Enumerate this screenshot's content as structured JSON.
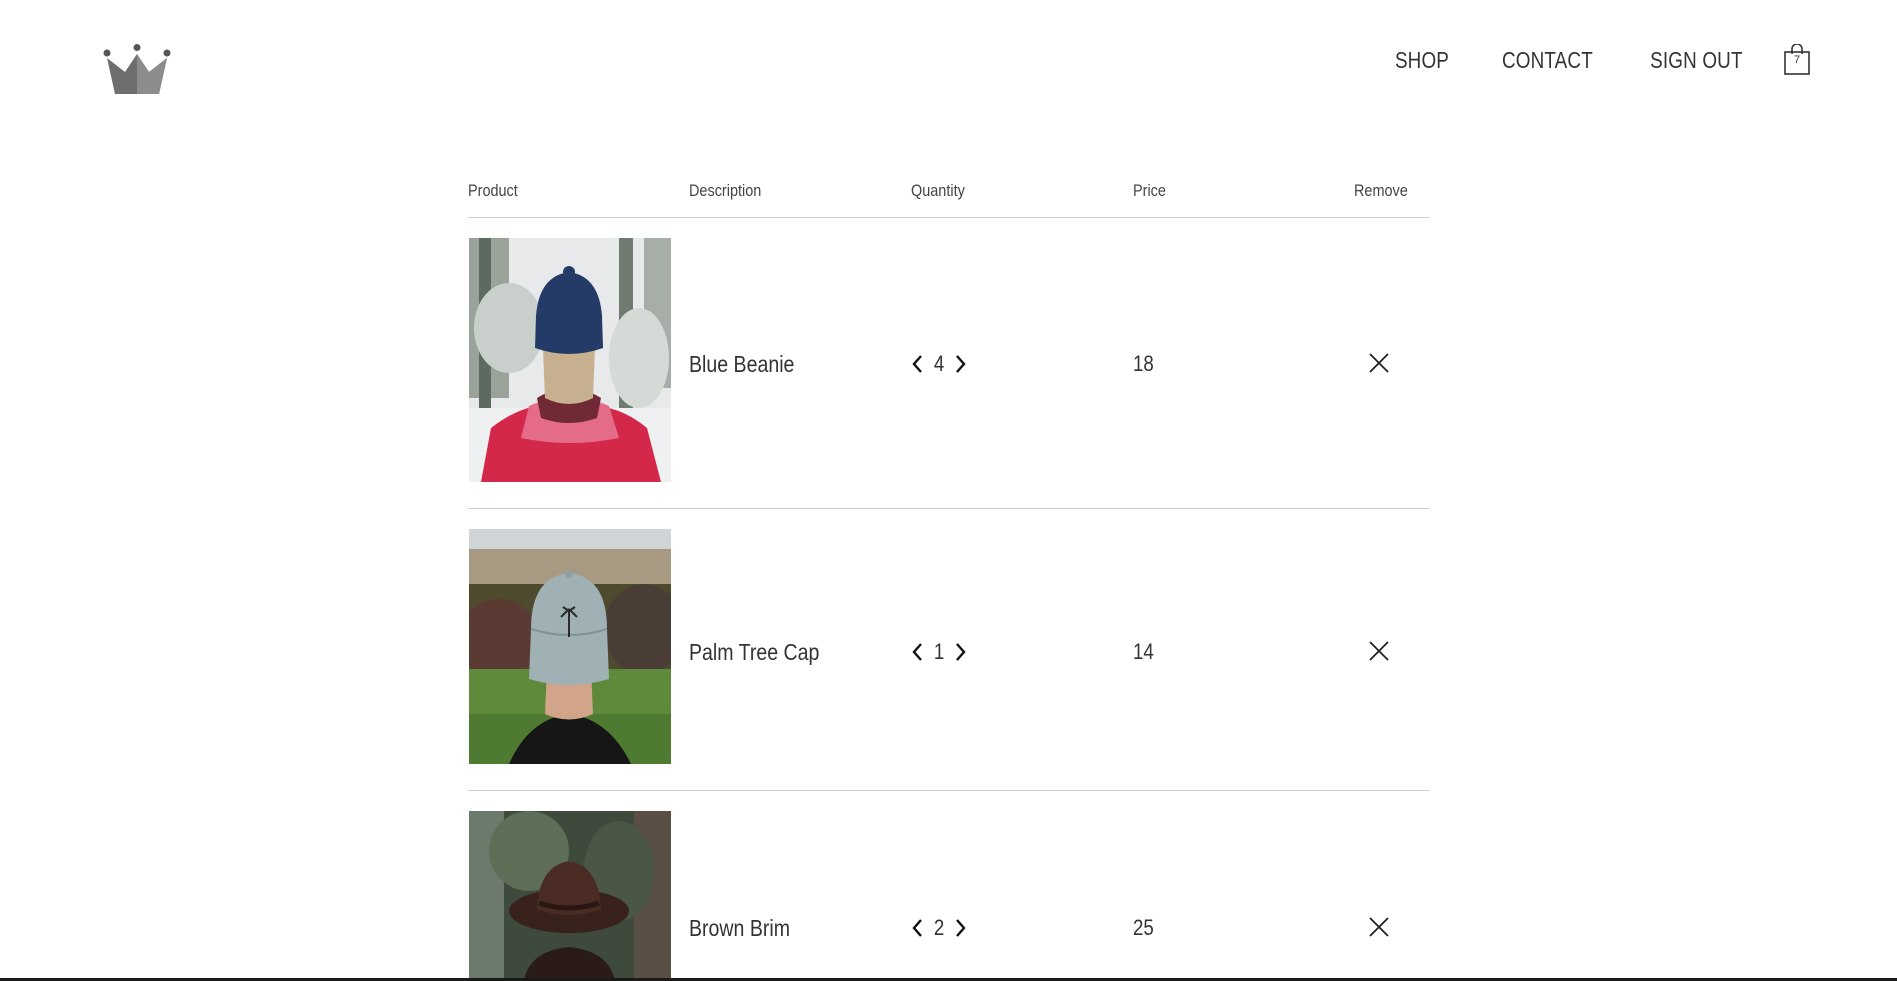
{
  "header": {
    "logo_icon": "crown-icon",
    "nav": {
      "shop": "SHOP",
      "contact": "CONTACT",
      "sign_out": "SIGN OUT"
    },
    "cart": {
      "icon": "shopping-bag-icon",
      "count": "7"
    }
  },
  "table": {
    "columns": {
      "product": "Product",
      "description": "Description",
      "quantity": "Quantity",
      "price": "Price",
      "remove": "Remove"
    },
    "rows": [
      {
        "name": "Blue Beanie",
        "quantity": "4",
        "price": "18"
      },
      {
        "name": "Palm Tree Cap",
        "quantity": "1",
        "price": "14"
      },
      {
        "name": "Brown Brim",
        "quantity": "2",
        "price": "25"
      }
    ]
  },
  "icons": {
    "decrement": "chevron-left-icon",
    "increment": "chevron-right-icon",
    "remove": "close-icon"
  },
  "colors": {
    "text": "#333333",
    "divider": "#cfcfcf",
    "logo": "#6e6e6e"
  }
}
